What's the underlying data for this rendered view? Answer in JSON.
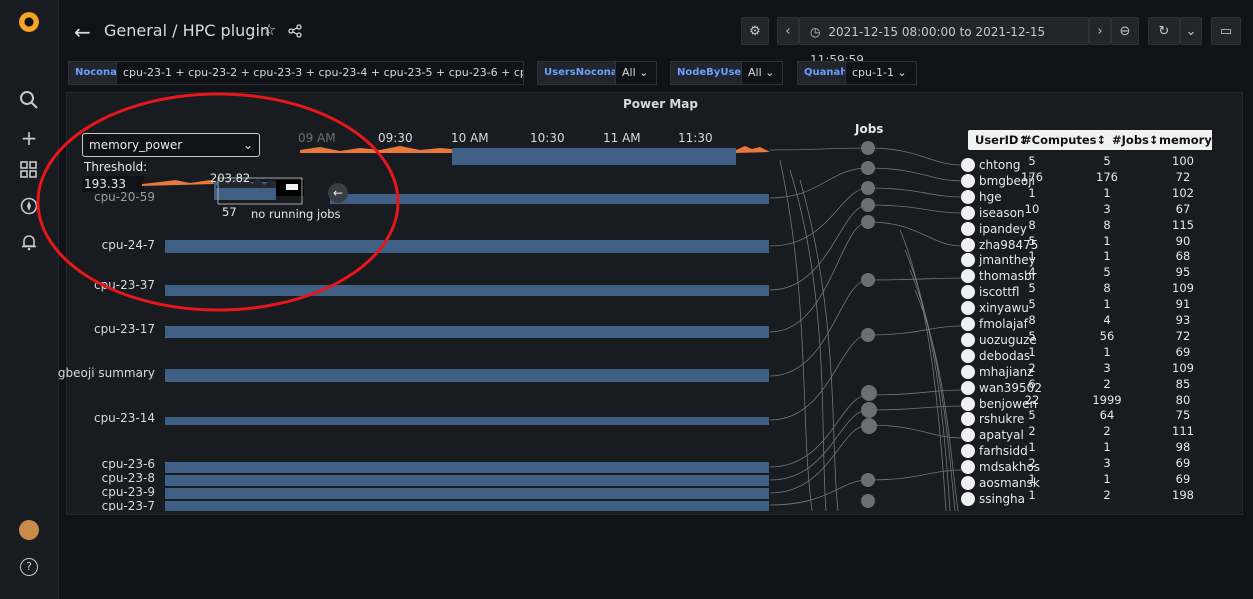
{
  "header": {
    "title": "General / HPC plugin",
    "time_range": "2021-12-15 08:00:00 to 2021-12-15 11:59:59"
  },
  "variables": [
    {
      "label": "Nocona",
      "value": "cpu-23-1 + cpu-23-2 + cpu-23-3 + cpu-23-4 + cpu-23-5 + cpu-23-6 + cpu-..."
    },
    {
      "label": "UsersNocona",
      "value": "All"
    },
    {
      "label": "NodeByUser",
      "value": "All"
    },
    {
      "label": "Quanah",
      "value": "cpu-1-1"
    }
  ],
  "panel": {
    "title": "Power Map",
    "jobs_title": "Jobs",
    "metric_select": "memory_power",
    "threshold_label": "Threshold:",
    "threshold_value": "193.33",
    "minimap_max": "203.82",
    "minimap_min": "57",
    "no_jobs_text": "no running jobs",
    "time_ticks": [
      "09 AM",
      "09:30",
      "10 AM",
      "10:30",
      "11 AM",
      "11:30"
    ],
    "row_labels": [
      "cpu-20-59",
      "cpu-24-7",
      "cpu-23-37",
      "cpu-23-17",
      "gbeoji summary",
      "cpu-23-14",
      "cpu-23-6",
      "cpu-23-8",
      "cpu-23-9",
      "cpu-23-7"
    ]
  },
  "table": {
    "headers": [
      "UserID↕",
      "#Computes↕",
      "#Jobs↕",
      "memory_pow"
    ],
    "rows": [
      {
        "user": "chtong",
        "computes": "5",
        "jobs": "5",
        "power": "100"
      },
      {
        "user": "bmgbeoji",
        "computes": "176",
        "jobs": "176",
        "power": "72"
      },
      {
        "user": "hge",
        "computes": "1",
        "jobs": "1",
        "power": "102"
      },
      {
        "user": "iseason",
        "computes": "10",
        "jobs": "3",
        "power": "67"
      },
      {
        "user": "ipandey",
        "computes": "8",
        "jobs": "8",
        "power": "115"
      },
      {
        "user": "zha98475",
        "computes": "5",
        "jobs": "1",
        "power": "90"
      },
      {
        "user": "jmanthey",
        "computes": "1",
        "jobs": "1",
        "power": "68"
      },
      {
        "user": "thomasbr",
        "computes": "4",
        "jobs": "5",
        "power": "95"
      },
      {
        "user": "iscottfl",
        "computes": "5",
        "jobs": "8",
        "power": "109"
      },
      {
        "user": "xinyawu",
        "computes": "5",
        "jobs": "1",
        "power": "91"
      },
      {
        "user": "fmolajaf",
        "computes": "8",
        "jobs": "4",
        "power": "93"
      },
      {
        "user": "uozuguze",
        "computes": "5",
        "jobs": "56",
        "power": "72"
      },
      {
        "user": "debodas",
        "computes": "1",
        "jobs": "1",
        "power": "69"
      },
      {
        "user": "mhajianz",
        "computes": "2",
        "jobs": "3",
        "power": "109"
      },
      {
        "user": "wan39502",
        "computes": "6",
        "jobs": "2",
        "power": "85"
      },
      {
        "user": "benjowen",
        "computes": "22",
        "jobs": "1999",
        "power": "80"
      },
      {
        "user": "rshukre",
        "computes": "5",
        "jobs": "64",
        "power": "75"
      },
      {
        "user": "apatyal",
        "computes": "2",
        "jobs": "2",
        "power": "111"
      },
      {
        "user": "farhsidd",
        "computes": "1",
        "jobs": "1",
        "power": "98"
      },
      {
        "user": "mdsakhos",
        "computes": "2",
        "jobs": "3",
        "power": "69"
      },
      {
        "user": "aosmansk",
        "computes": "1",
        "jobs": "1",
        "power": "69"
      },
      {
        "user": "ssingha",
        "computes": "1",
        "jobs": "2",
        "power": "198"
      }
    ]
  },
  "icons": {
    "back": "←",
    "star": "☆",
    "share": "⋖",
    "gear": "⚙",
    "clock": "◷",
    "zoom": "⊖",
    "refresh": "↻",
    "tv": "▭",
    "chev": "⌄",
    "search": "⌕",
    "plus": "+",
    "grid": "▦",
    "compass": "◎",
    "bell": "🔔︎",
    "help": "?"
  },
  "colors": {
    "bar": "#3f5f85",
    "accent_orange": "#e8793a",
    "annotation_red": "#e5171b",
    "var_label_blue": "#6e9fff"
  }
}
